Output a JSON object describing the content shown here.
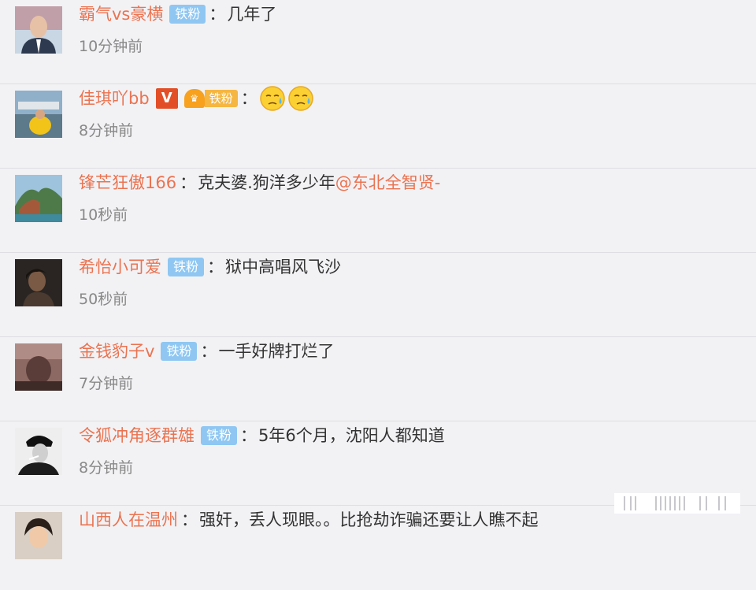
{
  "comments": [
    {
      "name": "霸气vs豪横",
      "badge": "铁粉",
      "text": "几年了",
      "time": "10分钟前"
    },
    {
      "name": "佳琪吖bb",
      "vip": "V",
      "gold_badge": "铁粉",
      "time": "8分钟前"
    },
    {
      "name": "锋芒狂傲166",
      "text": "克夫婆.狗洋多少年",
      "mention": "@东北全智贤-",
      "time": "10秒前"
    },
    {
      "name": "希怡小可爱",
      "badge": "铁粉",
      "text": "狱中高唱风飞沙",
      "time": "50秒前"
    },
    {
      "name": "金钱豹子v",
      "badge": "铁粉",
      "text": "一手好牌打烂了",
      "time": "7分钟前"
    },
    {
      "name": "令狐冲角逐群雄",
      "badge": "铁粉",
      "text": "5年6个月，沈阳人都知道",
      "time": "8分钟前"
    },
    {
      "name": "山西人在温州",
      "text": "强奸，丢人现眼。。比抢劫诈骗还要让人瞧不起"
    }
  ],
  "colon": "：",
  "icons": {
    "emoji": "sweat-smile-emoji",
    "crown": "crown-icon"
  }
}
